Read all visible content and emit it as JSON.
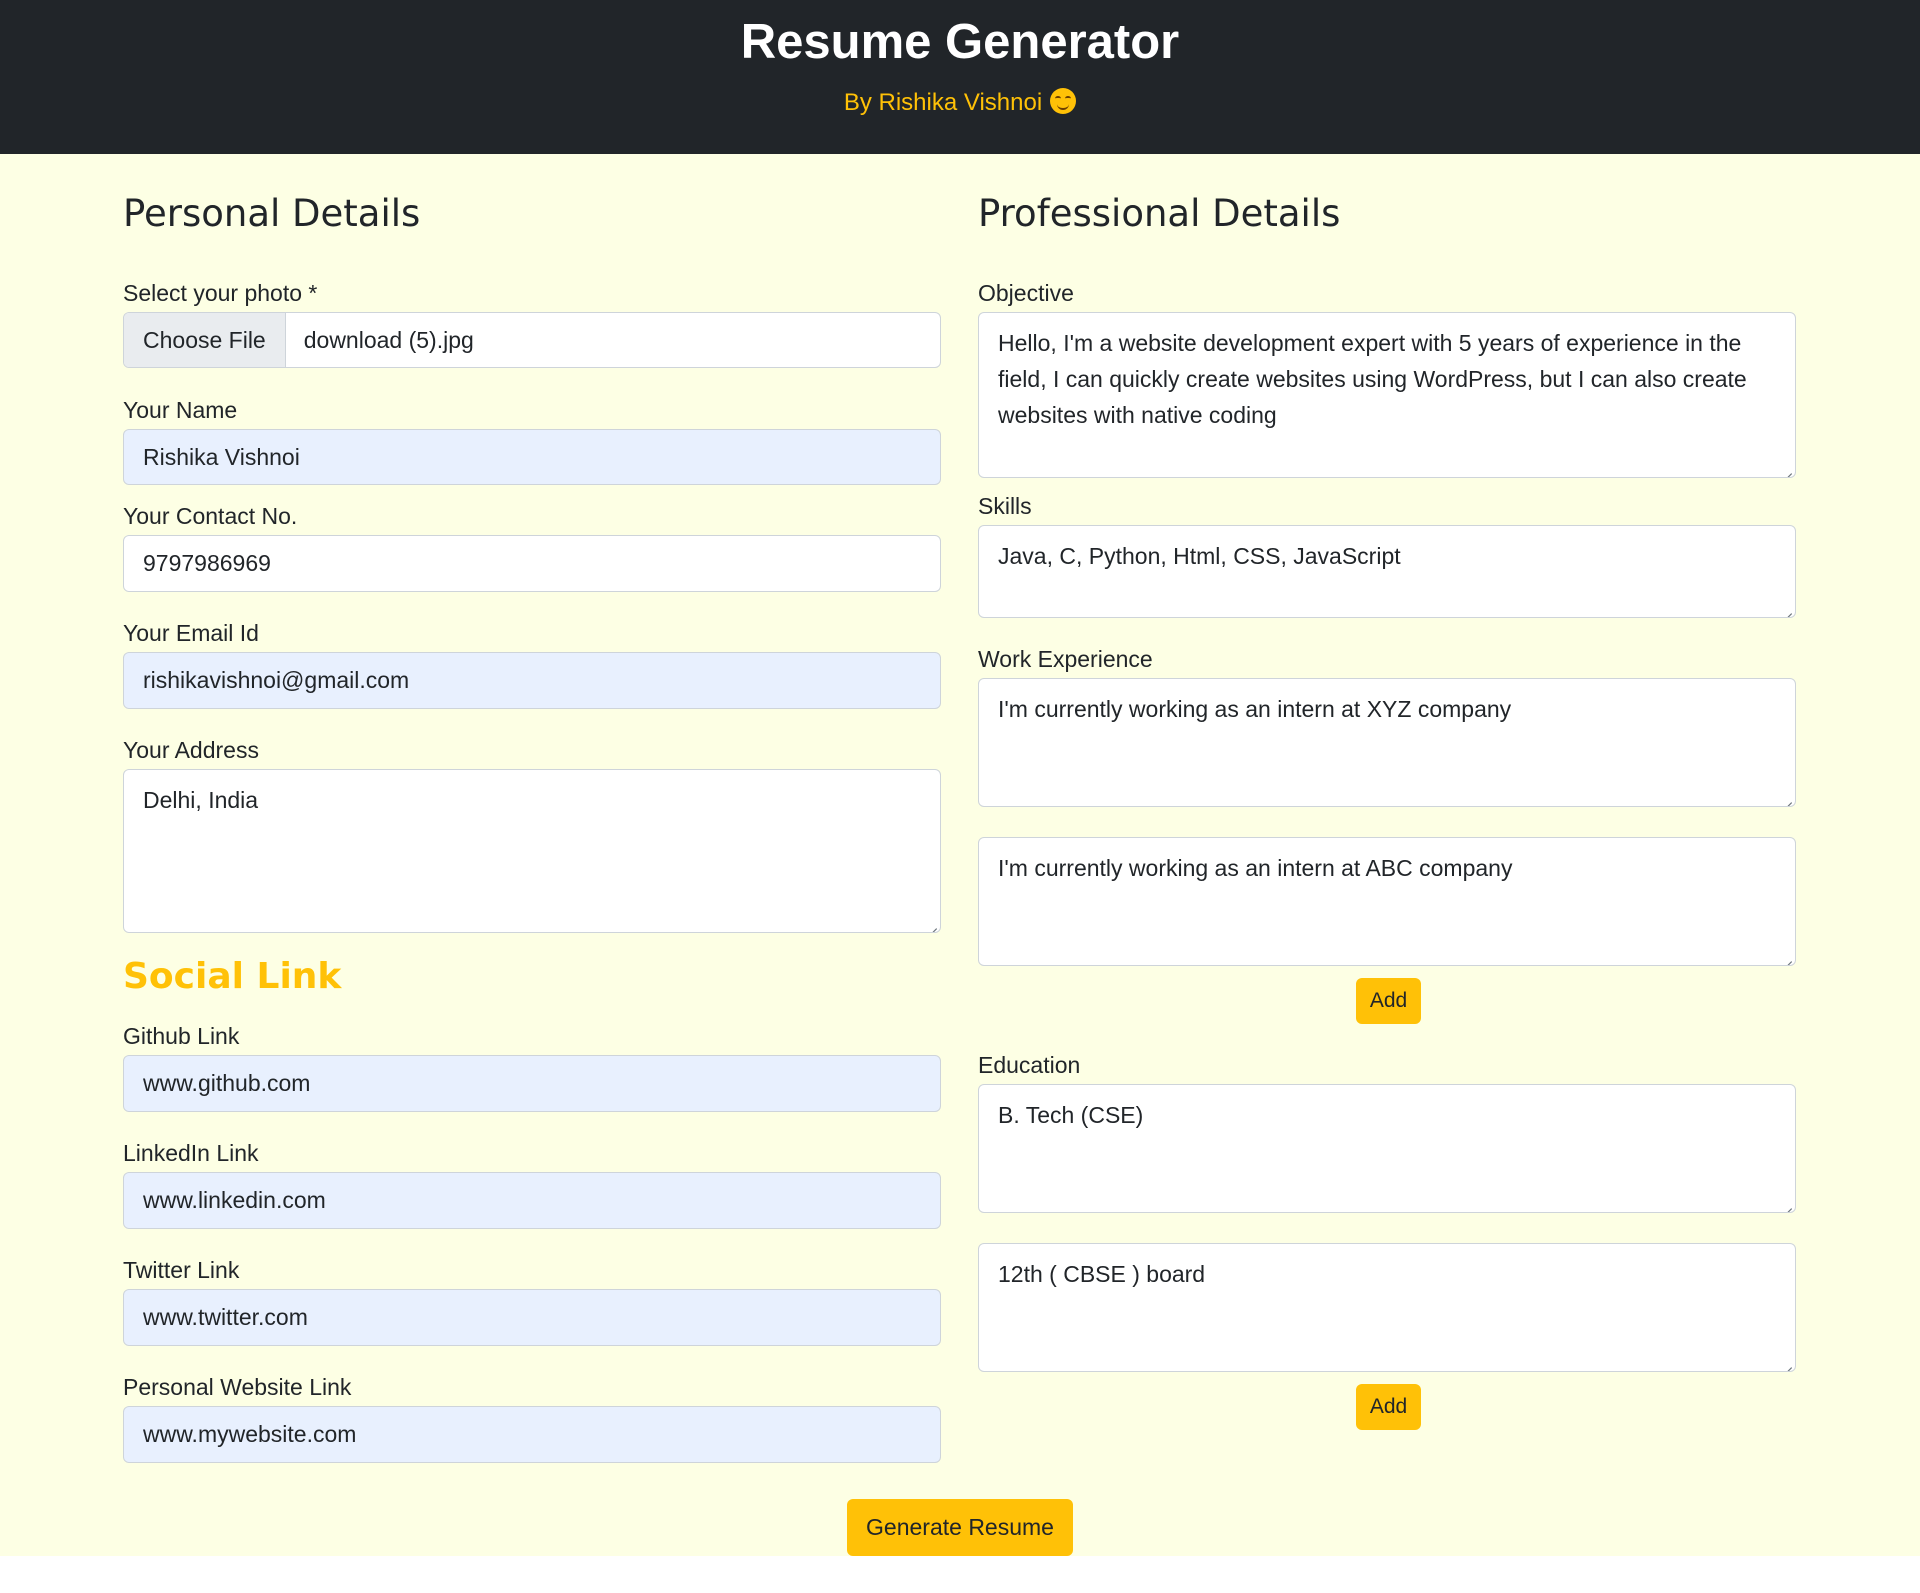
{
  "header": {
    "title": "Resume Generator",
    "byline": "By Rishika Vishnoi",
    "byline_icon": "smiling-face-icon"
  },
  "personal": {
    "title": "Personal Details",
    "photo": {
      "label": "Select your photo *",
      "button_label": "Choose File",
      "file_name": "download (5).jpg"
    },
    "name": {
      "label": "Your Name",
      "value": "Rishika Vishnoi"
    },
    "contact": {
      "label": "Your Contact No.",
      "value": "9797986969"
    },
    "email": {
      "label": "Your Email Id",
      "value": "rishikavishnoi@gmail.com"
    },
    "address": {
      "label": "Your Address",
      "value": "Delhi, India"
    }
  },
  "social": {
    "title": "Social Link",
    "github": {
      "label": "Github Link",
      "value": "www.github.com"
    },
    "linkedin": {
      "label": "LinkedIn Link",
      "value": "www.linkedin.com"
    },
    "twitter": {
      "label": "Twitter Link",
      "value": "www.twitter.com"
    },
    "website": {
      "label": "Personal Website Link",
      "value": "www.mywebsite.com"
    }
  },
  "professional": {
    "title": "Professional Details",
    "objective": {
      "label": "Objective",
      "value": "Hello,  I'm a website development expert with 5 years of experience in the field, I can quickly create websites using WordPress, but I can also create websites with native coding"
    },
    "skills": {
      "label": "Skills",
      "value": "Java, C, Python, Html, CSS, JavaScript"
    },
    "work": {
      "label": "Work Experience",
      "entries": [
        "I'm currently working as an intern at XYZ company",
        "I'm currently working as an intern at ABC company"
      ],
      "add_label": "Add"
    },
    "education": {
      "label": "Education",
      "entries": [
        "B. Tech (CSE)",
        "12th ( CBSE ) board"
      ],
      "add_label": "Add"
    }
  },
  "actions": {
    "generate_label": "Generate Resume"
  },
  "colors": {
    "header_bg": "#212529",
    "accent": "#ffc107",
    "page_bg": "#fdffe4",
    "autofill_bg": "#e8f0fe"
  }
}
